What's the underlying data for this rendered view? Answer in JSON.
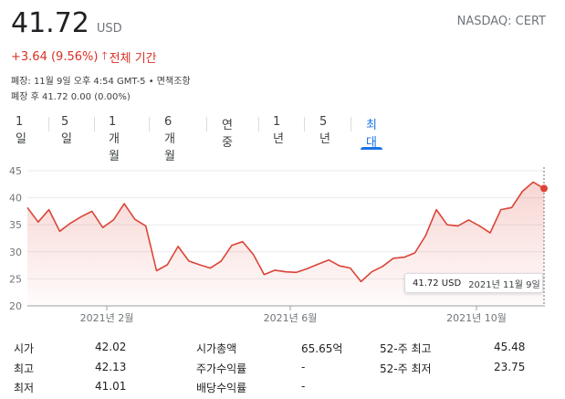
{
  "header": {
    "price": "41.72",
    "currency": "USD",
    "ticker": "NASDAQ: CERT",
    "change": "+3.64 (9.56%)",
    "change_arrow": "🡑",
    "change_period": "전체 기간",
    "close_info": "폐장: 11월 9일 오후 4:54 GMT-5 • 면책조항",
    "after_hours": "폐장 후 41.72 0.00 (0.00%)",
    "up_color": "#d93025"
  },
  "tabs": [
    {
      "label": "1일"
    },
    {
      "label": "5일"
    },
    {
      "label": "1개월"
    },
    {
      "label": "6개월"
    },
    {
      "label": "연중"
    },
    {
      "label": "1년"
    },
    {
      "label": "5년"
    },
    {
      "label": "최대"
    }
  ],
  "active_tab": "최대",
  "tooltip": {
    "price": "41.72 USD",
    "date": "2021년 11월 9일"
  },
  "chart_data": {
    "type": "line",
    "series": [
      {
        "values": [
          38.2,
          35.5,
          37.8,
          33.8,
          35.3,
          36.5,
          37.5,
          34.5,
          35.9,
          38.9,
          36.0,
          34.8,
          26.5,
          27.6,
          31.0,
          28.3,
          27.6,
          27.0,
          28.3,
          31.2,
          31.9,
          29.5,
          25.8,
          26.6,
          26.3,
          26.2,
          26.9,
          27.7,
          28.5,
          27.4,
          27.0,
          24.5,
          26.3,
          27.3,
          28.8,
          29.0,
          29.8,
          33.0,
          37.8,
          35.0,
          34.8,
          35.9,
          34.8,
          33.5,
          37.8,
          38.2,
          41.2,
          42.9,
          41.72
        ]
      }
    ],
    "ylim": [
      20,
      45
    ],
    "yticks": [
      "20",
      "25",
      "30",
      "35",
      "40",
      "45"
    ],
    "xticks": [
      "2021년 2월",
      "2021년 6월",
      "2021년 10월"
    ],
    "line_color": "#db4437",
    "grid": true
  },
  "stats": {
    "col1": [
      {
        "label": "시가",
        "value": "42.02"
      },
      {
        "label": "최고",
        "value": "42.13"
      },
      {
        "label": "최저",
        "value": "41.01"
      }
    ],
    "col2": [
      {
        "label": "시가총액",
        "value": "65.65억"
      },
      {
        "label": "주가수익률",
        "value": "-"
      },
      {
        "label": "배당수익률",
        "value": "-"
      }
    ],
    "col3": [
      {
        "label": "52-주 최고",
        "value": "45.48"
      },
      {
        "label": "52-주 최저",
        "value": "23.75"
      }
    ]
  }
}
